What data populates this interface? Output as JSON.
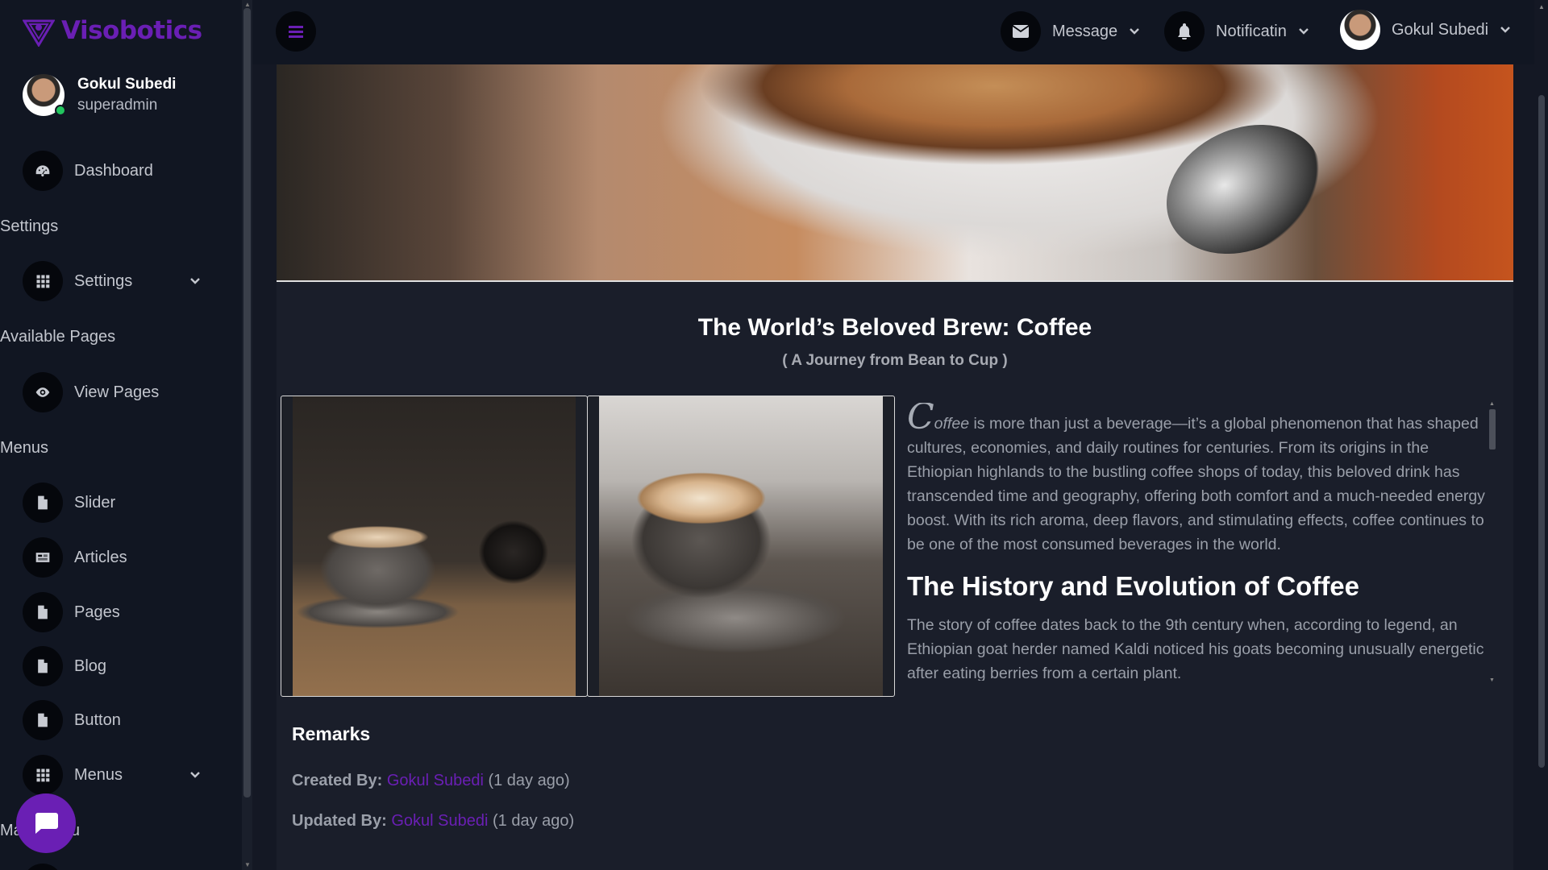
{
  "brand": {
    "name": "Visobotics",
    "color": "#6a1fb4"
  },
  "profile": {
    "name": "Gokul Subedi",
    "role": "superadmin"
  },
  "sidebar": {
    "dashboard": "Dashboard",
    "section_settings": "Settings",
    "settings": "Settings",
    "section_pages": "Available Pages",
    "view_pages": "View Pages",
    "section_menus": "Menus",
    "slider": "Slider",
    "articles": "Articles",
    "pages": "Pages",
    "blog": "Blog",
    "button": "Button",
    "menus": "Menus",
    "section_bottom": "Main Menu"
  },
  "topbar": {
    "message": "Message",
    "notification": "Notificatin",
    "user": "Gokul Subedi"
  },
  "article": {
    "title": "The World’s Beloved Brew: Coffee",
    "subtitle": "( A Journey from Bean to Cup )",
    "dropcap": "C",
    "lead_word": "offee",
    "intro_rest": " is more than just a beverage—it’s a global phenomenon that has shaped cultures, economies, and daily routines for centuries. From its origins in the Ethiopian highlands to the bustling coffee shops of today, this beloved drink has transcended time and geography, offering both comfort and a much-needed energy boost. With its rich aroma, deep flavors, and stimulating effects, coffee continues to be one of the most consumed beverages in the world.",
    "heading": "The History and Evolution of Coffee",
    "history": "The story of coffee dates back to the 9th century when, according to legend, an Ethiopian goat herder named Kaldi noticed his goats becoming unusually energetic after eating berries from a certain plant."
  },
  "remarks": {
    "title": "Remarks",
    "created_label": "Created By:",
    "created_by": "Gokul Subedi",
    "created_when": "(1 day ago)",
    "updated_label": "Updated By:",
    "updated_by": "Gokul Subedi",
    "updated_when": "(1 day ago)"
  }
}
